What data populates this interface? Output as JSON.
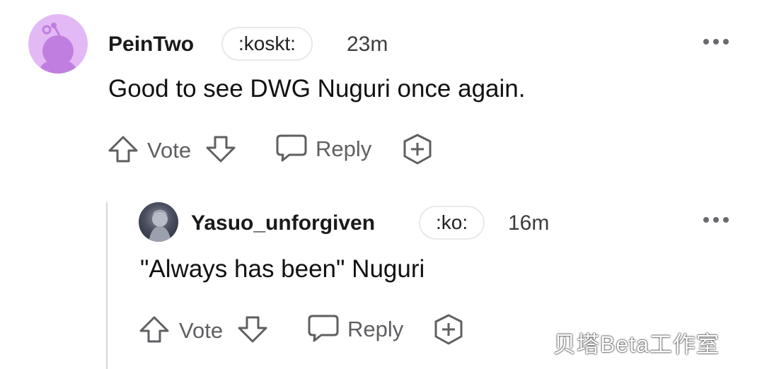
{
  "comments": [
    {
      "username": "PeinTwo",
      "flair": ":koskt:",
      "time": "23m",
      "body": "Good to see DWG Nuguri once again.",
      "actions": {
        "vote": "Vote",
        "reply": "Reply"
      }
    },
    {
      "username": "Yasuo_unforgiven",
      "flair": ":ko:",
      "time": "16m",
      "body": "\"Always has been\" Nuguri",
      "actions": {
        "vote": "Vote",
        "reply": "Reply"
      }
    }
  ],
  "watermark": "贝塔Beta工作室",
  "colors": {
    "avatar_bg": "#e3b9f5",
    "avatar_fg": "#c07fe0",
    "icon_gray": "#5f5f63",
    "thread_line": "#d7d7d9"
  },
  "icons": [
    "upvote-icon",
    "downvote-icon",
    "reply-bubble-icon",
    "award-icon",
    "more-options-icon"
  ]
}
